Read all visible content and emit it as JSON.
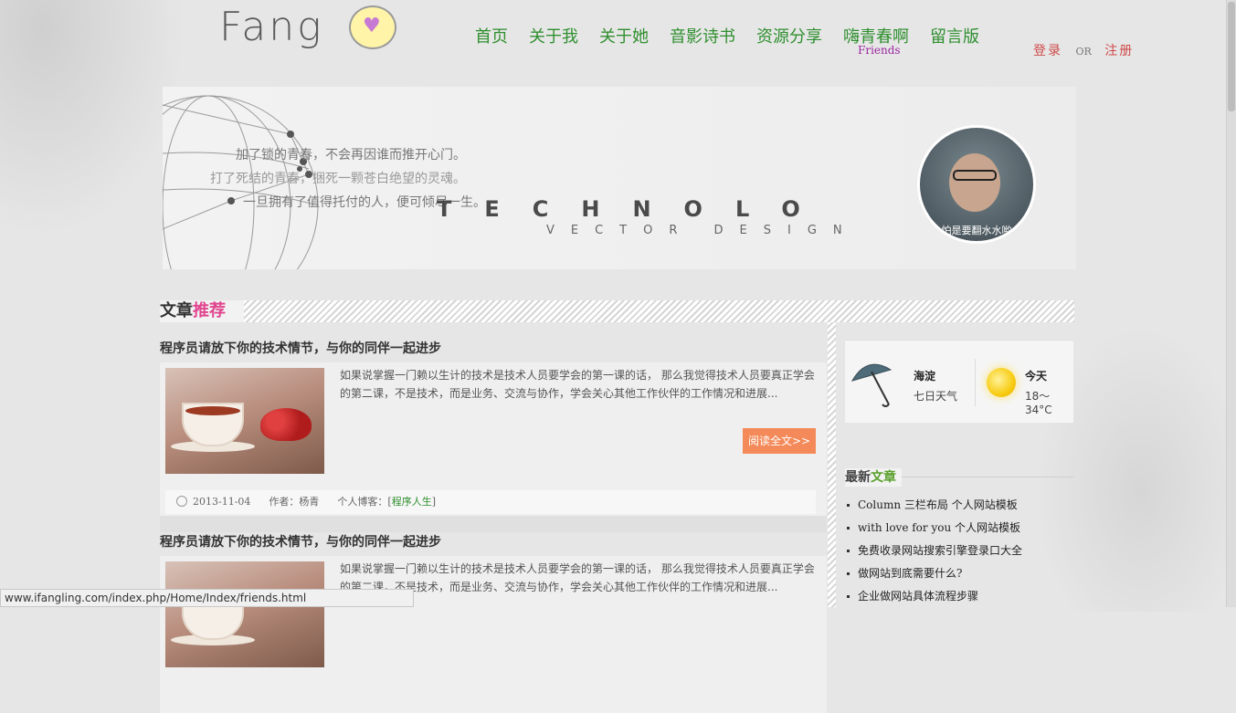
{
  "logo": {
    "text": "Fang",
    "icon": "heart-speech-bubble"
  },
  "nav": {
    "items": [
      {
        "label": "首页"
      },
      {
        "label": "关于我"
      },
      {
        "label": "关于她"
      },
      {
        "label": "音影诗书"
      },
      {
        "label": "资源分享"
      },
      {
        "label": "嗨青春啊",
        "sub": "Friends"
      },
      {
        "label": "留言版"
      }
    ]
  },
  "auth": {
    "login": "登录",
    "or": "OR",
    "register": "注册"
  },
  "banner": {
    "lines": [
      "加了锁的青春，不会再因谁而推开心门。",
      "打了死结的青春，捆死一颗苍白绝望的灵魂。",
      "一旦拥有了值得托付的人，便可倾尽一生。"
    ],
    "tech_text": "TECHNOLO",
    "vector_text": "VECTOR DESIGN",
    "avatar_caption": "怕是要翻水水哟"
  },
  "section": {
    "title_a": "文章",
    "title_b": "推荐"
  },
  "articles": [
    {
      "title": "程序员请放下你的技术情节，与你的同伴一起进步",
      "excerpt": "如果说掌握一门赖以生计的技术是技术人员要学会的第一课的话， 那么我觉得技术人员要真正学会的第二课，不是技术，而是业务、交流与协作，学会关心其他工作伙伴的工作情况和进展...",
      "read_more": "阅读全文>>",
      "date": "2013-11-04",
      "author": "作者：杨青",
      "blog_label": "个人博客：[",
      "category": "程序人生",
      "blog_close": "]"
    },
    {
      "title": "程序员请放下你的技术情节，与你的同伴一起进步",
      "excerpt": "如果说掌握一门赖以生计的技术是技术人员要学会的第一课的话， 那么我觉得技术人员要真正学会的第二课，不是技术，而是业务、交流与协作，学会关心其他工作伙伴的工作情况和进展..."
    }
  ],
  "weather": {
    "city": "海淀",
    "subtitle": "七日天气",
    "today": "今天",
    "temp": "18～34°C"
  },
  "latest": {
    "title_a": "最新",
    "title_b": "文章",
    "items": [
      "Column 三栏布局 个人网站模板",
      "with love for you 个人网站模板",
      "免费收录网站搜索引擎登录口大全",
      "做网站到底需要什么?",
      "企业做网站具体流程步骤"
    ]
  },
  "status_url": "www.ifangling.com/index.php/Home/Index/friends.html"
}
